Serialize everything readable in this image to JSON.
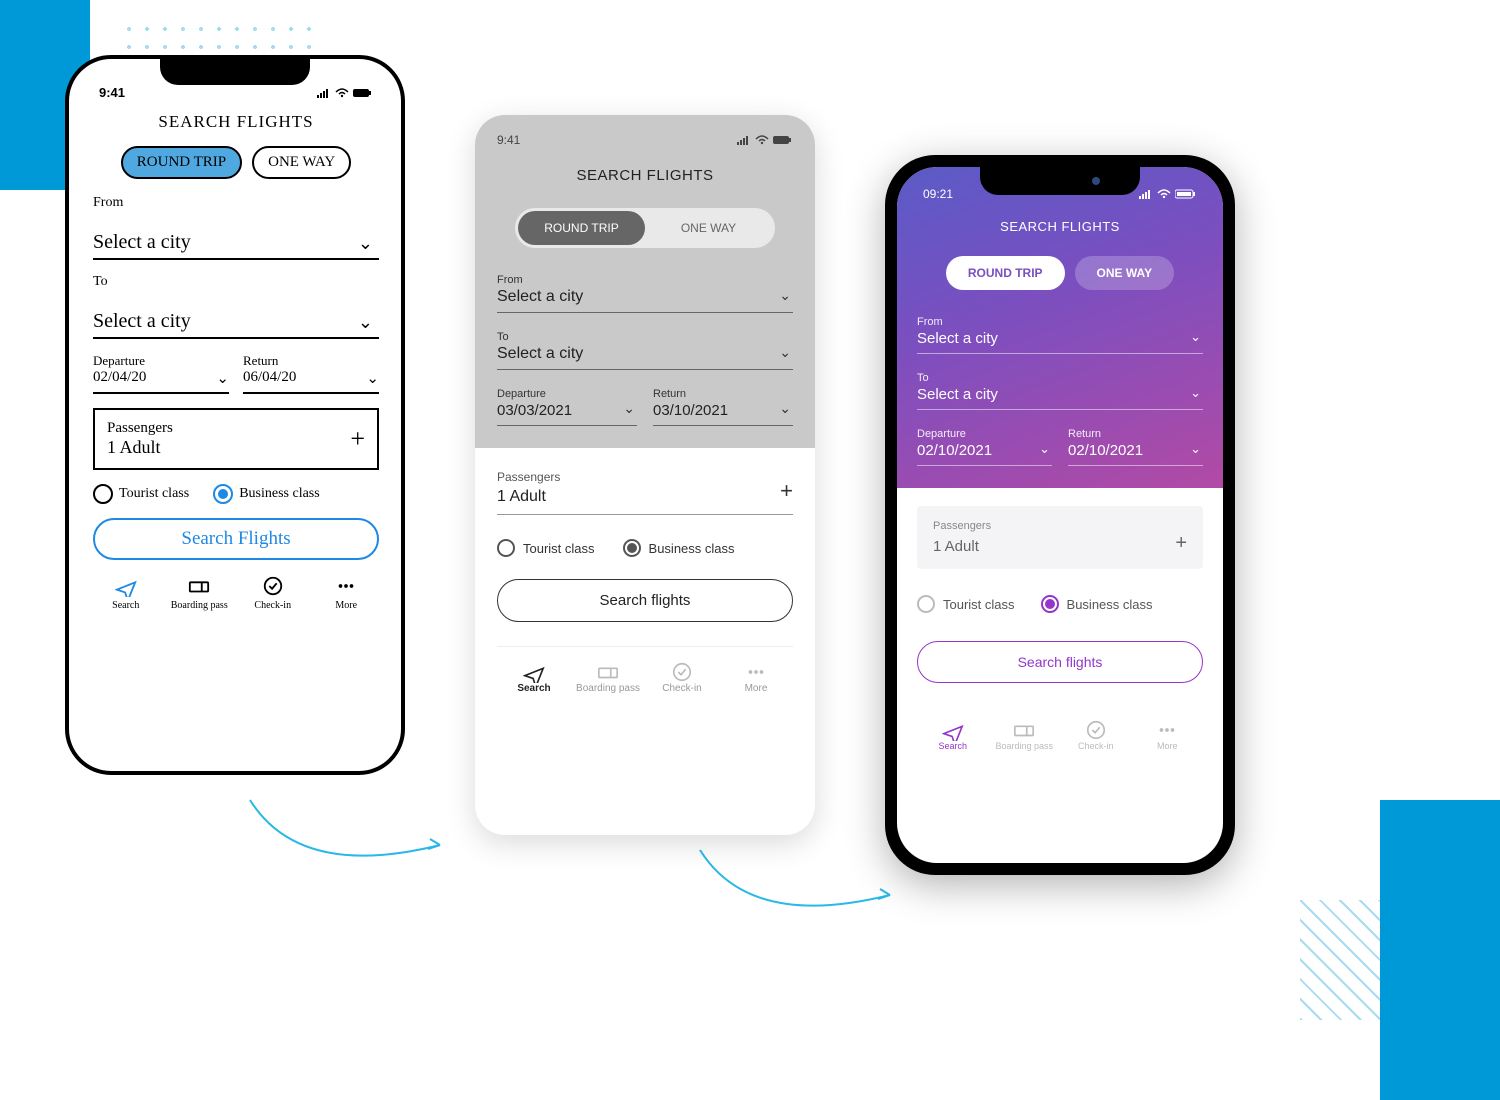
{
  "sketch": {
    "status_time": "9:41",
    "title": "SEARCH FLIGHTS",
    "trip_round": "ROUND TRIP",
    "trip_oneway": "ONE WAY",
    "from_label": "From",
    "from_value": "Select a city",
    "to_label": "To",
    "to_value": "Select a city",
    "departure_label": "Departure",
    "departure_value": "02/04/20",
    "return_label": "Return",
    "return_value": "06/04/20",
    "passengers_label": "Passengers",
    "passengers_value": "1 Adult",
    "class_tourist": "Tourist class",
    "class_business": "Business class",
    "search_button": "Search Flights",
    "nav": {
      "search": "Search",
      "boarding": "Boarding pass",
      "checkin": "Check-in",
      "more": "More"
    }
  },
  "wire": {
    "status_time": "9:41",
    "title": "SEARCH FLIGHTS",
    "trip_round": "ROUND TRIP",
    "trip_oneway": "ONE WAY",
    "from_label": "From",
    "from_value": "Select a city",
    "to_label": "To",
    "to_value": "Select a city",
    "departure_label": "Departure",
    "departure_value": "03/03/2021",
    "return_label": "Return",
    "return_value": "03/10/2021",
    "passengers_label": "Passengers",
    "passengers_value": "1 Adult",
    "class_tourist": "Tourist class",
    "class_business": "Business class",
    "search_button": "Search flights",
    "nav": {
      "search": "Search",
      "boarding": "Boarding pass",
      "checkin": "Check-in",
      "more": "More"
    }
  },
  "hifi": {
    "status_time": "09:21",
    "title": "SEARCH FLIGHTS",
    "trip_round": "ROUND TRIP",
    "trip_oneway": "ONE WAY",
    "from_label": "From",
    "from_value": "Select a city",
    "to_label": "To",
    "to_value": "Select a city",
    "departure_label": "Departure",
    "departure_value": "02/10/2021",
    "return_label": "Return",
    "return_value": "02/10/2021",
    "passengers_label": "Passengers",
    "passengers_value": "1 Adult",
    "class_tourist": "Tourist class",
    "class_business": "Business class",
    "search_button": "Search flights",
    "nav": {
      "search": "Search",
      "boarding": "Boarding pass",
      "checkin": "Check-in",
      "more": "More"
    }
  }
}
